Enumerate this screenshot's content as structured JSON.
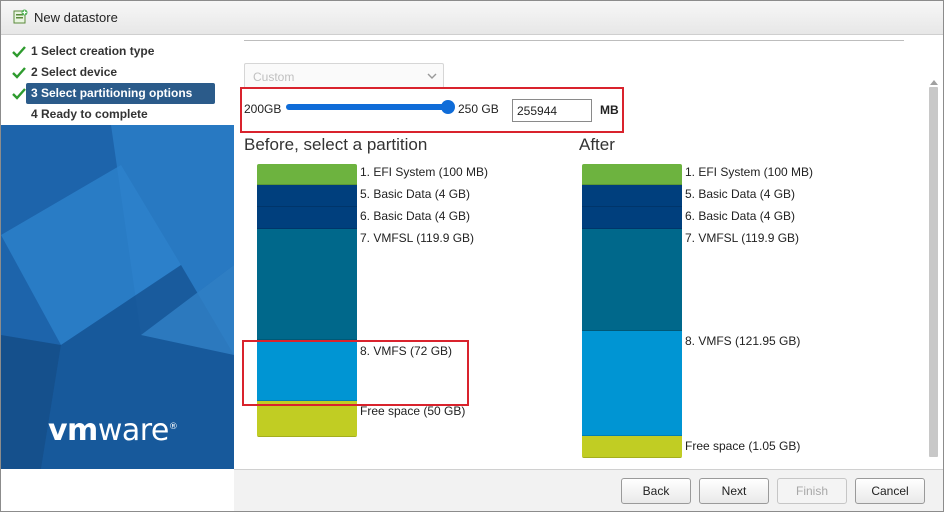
{
  "window": {
    "title": "New datastore"
  },
  "steps": [
    {
      "label": "1  Select creation type",
      "state": "done"
    },
    {
      "label": "2  Select device",
      "state": "done"
    },
    {
      "label": "3  Select partitioning options",
      "state": "active"
    },
    {
      "label": "4  Ready to complete",
      "state": "pending"
    }
  ],
  "branding": {
    "logo_vm": "vm",
    "logo_ware": "ware",
    "logo_reg": "®"
  },
  "partition_config": {
    "select_value": "Custom",
    "slider_min_label": "200GB",
    "slider_max_label": "250 GB",
    "slider_fraction": 1.0,
    "size_value": "255944",
    "size_unit": "MB"
  },
  "before": {
    "heading": "Before, select a partition",
    "partitions": [
      {
        "label": "1. EFI System   (100 MB)",
        "color": "#6db33f"
      },
      {
        "label": "5. Basic Data   (4 GB)",
        "color": "#003f7d"
      },
      {
        "label": "6. Basic Data   (4 GB)",
        "color": "#003f7d"
      },
      {
        "label": "7. VMFSL   (119.9 GB)",
        "color": "#00688b"
      },
      {
        "label": "8. VMFS   (72 GB)",
        "color": "#0095d3"
      },
      {
        "label": "Free space   (50 GB)",
        "color": "#c1cd23"
      }
    ]
  },
  "after": {
    "heading": "After",
    "partitions": [
      {
        "label": "1. EFI System   (100 MB)",
        "color": "#6db33f"
      },
      {
        "label": "5. Basic Data   (4 GB)",
        "color": "#003f7d"
      },
      {
        "label": "6. Basic Data   (4 GB)",
        "color": "#003f7d"
      },
      {
        "label": "7. VMFSL   (119.9 GB)",
        "color": "#00688b"
      },
      {
        "label": "8. VMFS   (121.95 GB)",
        "color": "#0095d3"
      },
      {
        "label": "Free space   (1.05 GB)",
        "color": "#c1cd23"
      }
    ]
  },
  "buttons": {
    "back": "Back",
    "next": "Next",
    "finish": "Finish",
    "cancel": "Cancel"
  },
  "colors": {
    "accent": "#0f6cd8",
    "highlight_box": "#d9232d",
    "active_step": "#2b5b8a",
    "sidebar": "#1b5fa2"
  }
}
